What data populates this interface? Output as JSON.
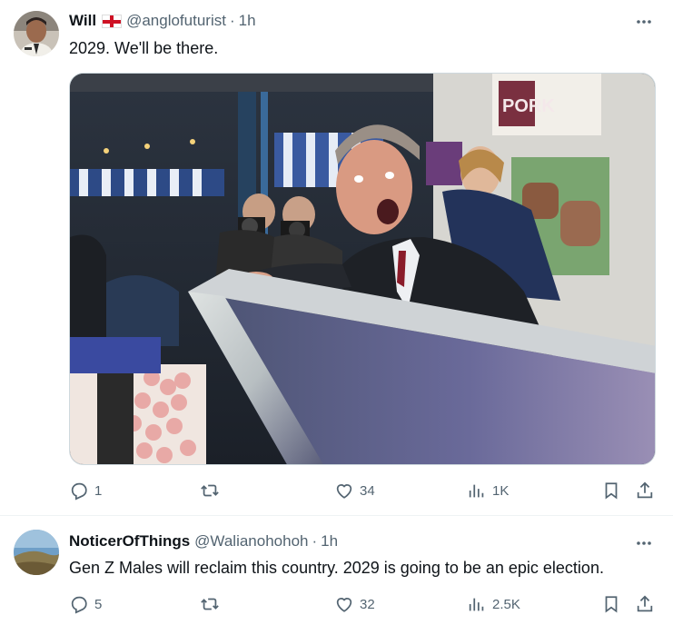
{
  "tweets": [
    {
      "display_name": "Will",
      "handle": "@anglofuturist",
      "separator": "·",
      "time": "1h",
      "text": "2029. We'll be there.",
      "flag_icon": "england-flag-icon",
      "stats": {
        "replies": "1",
        "reposts": "",
        "likes": "34",
        "views": "1K"
      }
    },
    {
      "display_name": "NoticerOfThings",
      "handle": "@Walianohohoh",
      "separator": "·",
      "time": "1h",
      "text": "Gen Z Males will reclaim this country. 2029 is going to be an epic election.",
      "stats": {
        "replies": "5",
        "reposts": "",
        "likes": "32",
        "views": "2.5K"
      }
    }
  ],
  "media": {
    "shop_sign": "PORK"
  },
  "colors": {
    "text_primary": "#0f1419",
    "text_secondary": "#536471",
    "border": "#cfd9de"
  }
}
